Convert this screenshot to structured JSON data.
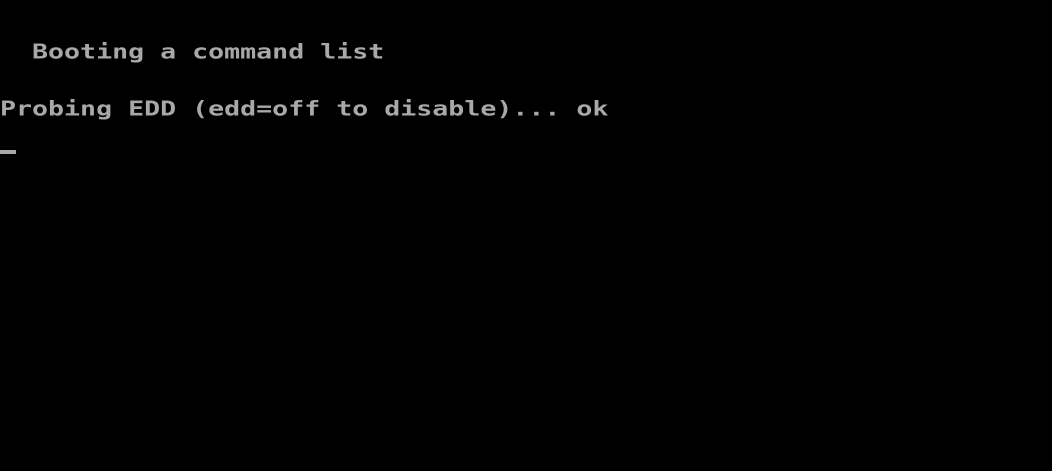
{
  "console": {
    "lines": [
      "  Booting a command list",
      "Probing EDD (edd=off to disable)... ok"
    ],
    "text_color": "#a8a8a8",
    "background_color": "#000000"
  }
}
